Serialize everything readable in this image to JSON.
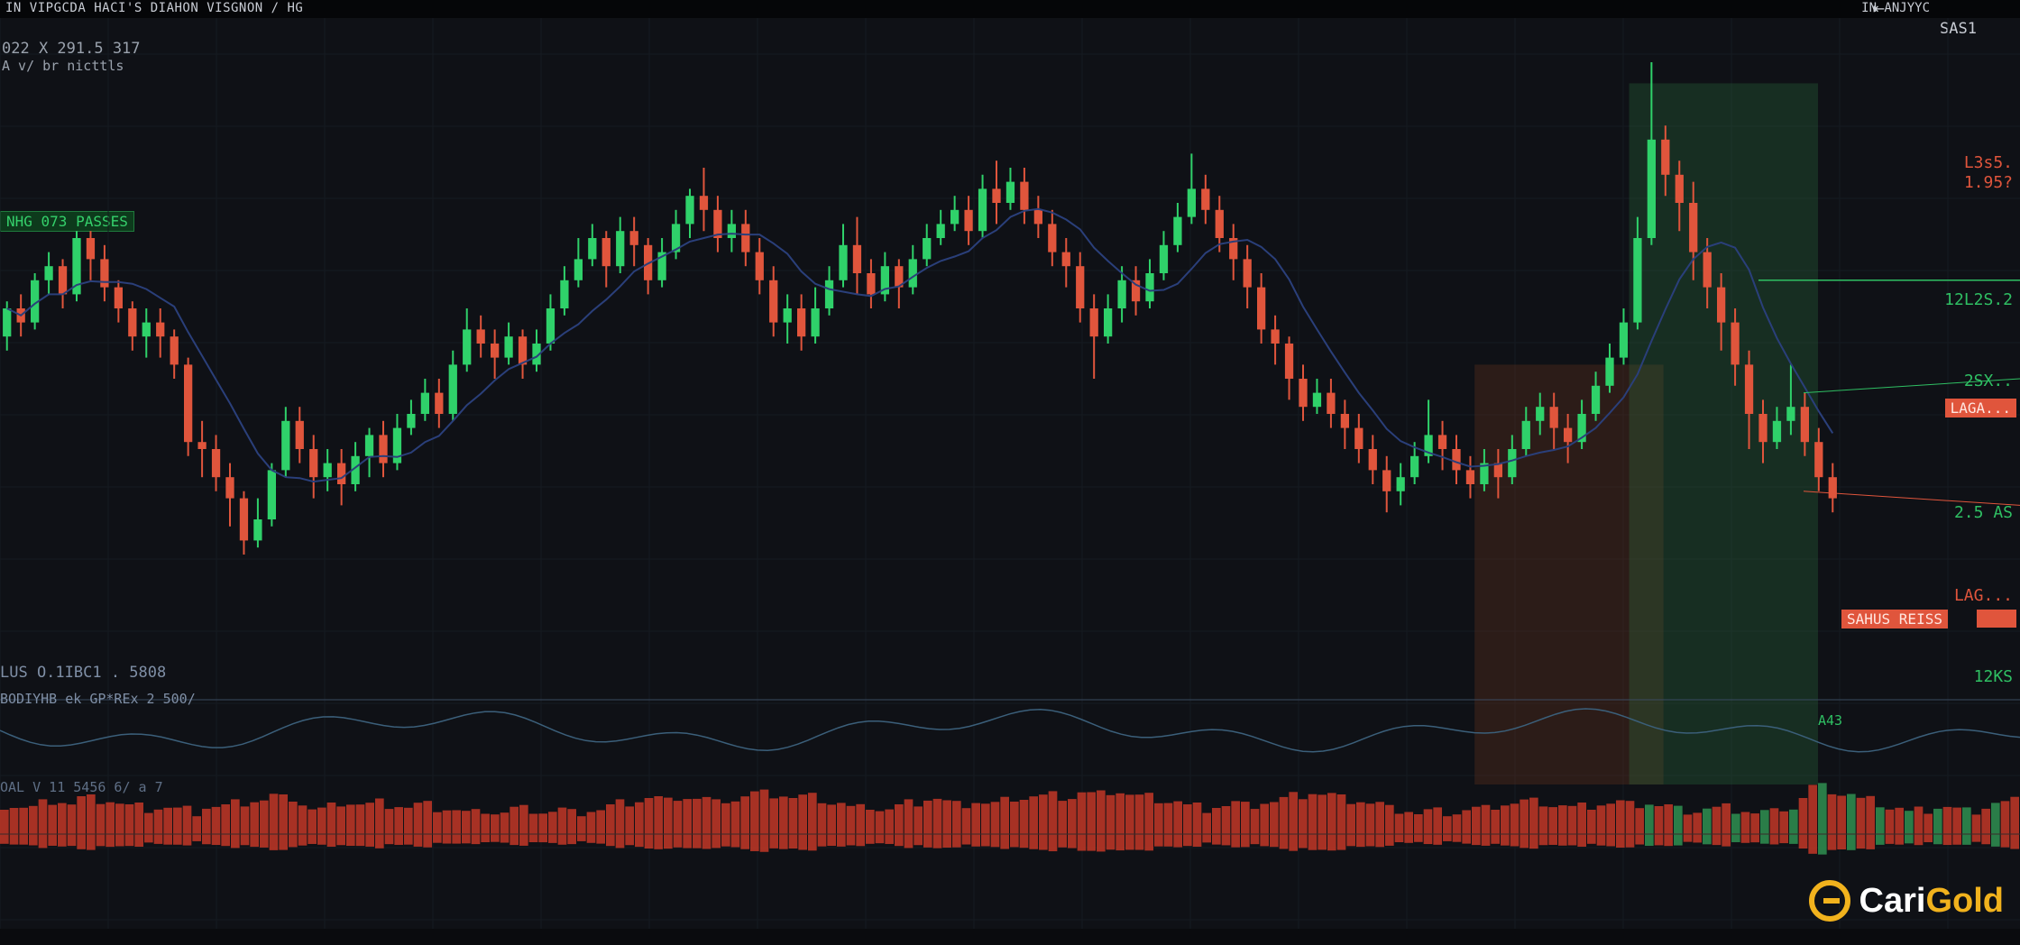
{
  "header": {
    "title": "IN VIPGCDA HACI'S DIAHON VISGNON / HG",
    "ticker": "IN ANJYYC",
    "sub_ticker": "SAS1"
  },
  "info": {
    "line1": "022 X 291.5 317",
    "line2": "A v/ br nicttls"
  },
  "badges": {
    "left_green": "NHG 073 PASSES",
    "price_red": "LAGA...",
    "sell_tag": "SAHUS REISS"
  },
  "right_axis": [
    {
      "label": "L3s5.",
      "color": "#e0553c"
    },
    {
      "label": "1.95?",
      "color": "#e0553c"
    },
    {
      "label": "12L2S.2",
      "color": "#2fbf63"
    },
    {
      "label": "2SX..",
      "color": "#2fbf63"
    },
    {
      "label": "2.5 AS",
      "color": "#2fbf63"
    },
    {
      "label": "LAG...",
      "color": "#e0553c"
    },
    {
      "label": "12KS",
      "color": "#2fbf63"
    },
    {
      "label": "A43",
      "color": "#2fbf63"
    }
  ],
  "indicators": {
    "line1": "LUS O.1IBC1 . 5808",
    "line2": "BODIYHB ek GP*REx 2 500/",
    "line3": "OAL V 11 5456 6/ a 7"
  },
  "brand": {
    "part1": "Cari",
    "part2": "Gold"
  },
  "chart_data": {
    "type": "candlestick",
    "title": "",
    "colors": {
      "up": "#2fd16a",
      "down": "#e0553c",
      "ma": "#2a3f7a",
      "bg": "#0f1116"
    },
    "candles": [
      [
        0.56,
        0.6,
        0.54,
        0.61
      ],
      [
        0.6,
        0.58,
        0.56,
        0.62
      ],
      [
        0.58,
        0.64,
        0.57,
        0.65
      ],
      [
        0.64,
        0.66,
        0.62,
        0.68
      ],
      [
        0.66,
        0.62,
        0.6,
        0.67
      ],
      [
        0.62,
        0.7,
        0.61,
        0.71
      ],
      [
        0.7,
        0.67,
        0.64,
        0.71
      ],
      [
        0.67,
        0.63,
        0.61,
        0.69
      ],
      [
        0.63,
        0.6,
        0.58,
        0.64
      ],
      [
        0.6,
        0.56,
        0.54,
        0.61
      ],
      [
        0.56,
        0.58,
        0.53,
        0.6
      ],
      [
        0.58,
        0.56,
        0.53,
        0.6
      ],
      [
        0.56,
        0.52,
        0.5,
        0.57
      ],
      [
        0.52,
        0.41,
        0.39,
        0.53
      ],
      [
        0.41,
        0.4,
        0.36,
        0.44
      ],
      [
        0.4,
        0.36,
        0.34,
        0.42
      ],
      [
        0.36,
        0.33,
        0.29,
        0.38
      ],
      [
        0.33,
        0.27,
        0.25,
        0.34
      ],
      [
        0.27,
        0.3,
        0.26,
        0.33
      ],
      [
        0.3,
        0.37,
        0.29,
        0.38
      ],
      [
        0.37,
        0.44,
        0.36,
        0.46
      ],
      [
        0.44,
        0.4,
        0.38,
        0.46
      ],
      [
        0.4,
        0.36,
        0.33,
        0.42
      ],
      [
        0.36,
        0.38,
        0.34,
        0.4
      ],
      [
        0.38,
        0.35,
        0.32,
        0.4
      ],
      [
        0.35,
        0.39,
        0.34,
        0.41
      ],
      [
        0.39,
        0.42,
        0.36,
        0.43
      ],
      [
        0.42,
        0.38,
        0.36,
        0.44
      ],
      [
        0.38,
        0.43,
        0.37,
        0.45
      ],
      [
        0.43,
        0.45,
        0.42,
        0.47
      ],
      [
        0.45,
        0.48,
        0.44,
        0.5
      ],
      [
        0.48,
        0.45,
        0.43,
        0.5
      ],
      [
        0.45,
        0.52,
        0.44,
        0.54
      ],
      [
        0.52,
        0.57,
        0.51,
        0.6
      ],
      [
        0.57,
        0.55,
        0.53,
        0.59
      ],
      [
        0.55,
        0.53,
        0.5,
        0.57
      ],
      [
        0.53,
        0.56,
        0.52,
        0.58
      ],
      [
        0.56,
        0.52,
        0.5,
        0.57
      ],
      [
        0.52,
        0.55,
        0.51,
        0.57
      ],
      [
        0.55,
        0.6,
        0.54,
        0.62
      ],
      [
        0.6,
        0.64,
        0.59,
        0.66
      ],
      [
        0.64,
        0.67,
        0.63,
        0.7
      ],
      [
        0.67,
        0.7,
        0.66,
        0.72
      ],
      [
        0.7,
        0.66,
        0.63,
        0.71
      ],
      [
        0.66,
        0.71,
        0.65,
        0.73
      ],
      [
        0.71,
        0.69,
        0.66,
        0.73
      ],
      [
        0.69,
        0.64,
        0.62,
        0.7
      ],
      [
        0.64,
        0.68,
        0.63,
        0.7
      ],
      [
        0.68,
        0.72,
        0.67,
        0.74
      ],
      [
        0.72,
        0.76,
        0.7,
        0.77
      ],
      [
        0.76,
        0.74,
        0.71,
        0.8
      ],
      [
        0.74,
        0.7,
        0.68,
        0.76
      ],
      [
        0.7,
        0.72,
        0.68,
        0.74
      ],
      [
        0.72,
        0.68,
        0.66,
        0.74
      ],
      [
        0.68,
        0.64,
        0.62,
        0.7
      ],
      [
        0.64,
        0.58,
        0.56,
        0.66
      ],
      [
        0.58,
        0.6,
        0.55,
        0.62
      ],
      [
        0.6,
        0.56,
        0.54,
        0.62
      ],
      [
        0.56,
        0.6,
        0.55,
        0.63
      ],
      [
        0.6,
        0.64,
        0.59,
        0.66
      ],
      [
        0.64,
        0.69,
        0.63,
        0.72
      ],
      [
        0.69,
        0.65,
        0.62,
        0.73
      ],
      [
        0.65,
        0.62,
        0.6,
        0.67
      ],
      [
        0.62,
        0.66,
        0.61,
        0.68
      ],
      [
        0.66,
        0.63,
        0.6,
        0.67
      ],
      [
        0.63,
        0.67,
        0.62,
        0.69
      ],
      [
        0.67,
        0.7,
        0.66,
        0.72
      ],
      [
        0.7,
        0.72,
        0.69,
        0.74
      ],
      [
        0.72,
        0.74,
        0.71,
        0.76
      ],
      [
        0.74,
        0.71,
        0.69,
        0.76
      ],
      [
        0.71,
        0.77,
        0.7,
        0.79
      ],
      [
        0.77,
        0.75,
        0.72,
        0.81
      ],
      [
        0.75,
        0.78,
        0.74,
        0.8
      ],
      [
        0.78,
        0.74,
        0.72,
        0.8
      ],
      [
        0.74,
        0.72,
        0.7,
        0.76
      ],
      [
        0.72,
        0.68,
        0.66,
        0.74
      ],
      [
        0.68,
        0.66,
        0.63,
        0.7
      ],
      [
        0.66,
        0.6,
        0.58,
        0.68
      ],
      [
        0.6,
        0.56,
        0.5,
        0.62
      ],
      [
        0.56,
        0.6,
        0.55,
        0.62
      ],
      [
        0.6,
        0.64,
        0.58,
        0.66
      ],
      [
        0.64,
        0.61,
        0.59,
        0.66
      ],
      [
        0.61,
        0.65,
        0.6,
        0.67
      ],
      [
        0.65,
        0.69,
        0.64,
        0.71
      ],
      [
        0.69,
        0.73,
        0.68,
        0.75
      ],
      [
        0.73,
        0.77,
        0.72,
        0.82
      ],
      [
        0.77,
        0.74,
        0.72,
        0.79
      ],
      [
        0.74,
        0.7,
        0.68,
        0.76
      ],
      [
        0.7,
        0.67,
        0.64,
        0.72
      ],
      [
        0.67,
        0.63,
        0.6,
        0.69
      ],
      [
        0.63,
        0.57,
        0.55,
        0.65
      ],
      [
        0.57,
        0.55,
        0.52,
        0.59
      ],
      [
        0.55,
        0.5,
        0.47,
        0.56
      ],
      [
        0.5,
        0.46,
        0.44,
        0.52
      ],
      [
        0.46,
        0.48,
        0.45,
        0.5
      ],
      [
        0.48,
        0.45,
        0.43,
        0.5
      ],
      [
        0.45,
        0.43,
        0.4,
        0.47
      ],
      [
        0.43,
        0.4,
        0.38,
        0.45
      ],
      [
        0.4,
        0.37,
        0.35,
        0.42
      ],
      [
        0.37,
        0.34,
        0.31,
        0.39
      ],
      [
        0.34,
        0.36,
        0.32,
        0.38
      ],
      [
        0.36,
        0.39,
        0.35,
        0.41
      ],
      [
        0.39,
        0.42,
        0.38,
        0.47
      ],
      [
        0.42,
        0.4,
        0.37,
        0.44
      ],
      [
        0.4,
        0.37,
        0.35,
        0.42
      ],
      [
        0.37,
        0.35,
        0.33,
        0.39
      ],
      [
        0.35,
        0.38,
        0.34,
        0.4
      ],
      [
        0.38,
        0.36,
        0.33,
        0.4
      ],
      [
        0.36,
        0.4,
        0.35,
        0.42
      ],
      [
        0.4,
        0.44,
        0.39,
        0.46
      ],
      [
        0.44,
        0.46,
        0.42,
        0.48
      ],
      [
        0.46,
        0.43,
        0.4,
        0.48
      ],
      [
        0.43,
        0.41,
        0.38,
        0.45
      ],
      [
        0.41,
        0.45,
        0.4,
        0.47
      ],
      [
        0.45,
        0.49,
        0.44,
        0.51
      ],
      [
        0.49,
        0.53,
        0.48,
        0.55
      ],
      [
        0.53,
        0.58,
        0.52,
        0.6
      ],
      [
        0.58,
        0.7,
        0.57,
        0.73
      ],
      [
        0.7,
        0.84,
        0.69,
        0.95
      ],
      [
        0.84,
        0.79,
        0.76,
        0.86
      ],
      [
        0.79,
        0.75,
        0.71,
        0.81
      ],
      [
        0.75,
        0.68,
        0.64,
        0.78
      ],
      [
        0.68,
        0.63,
        0.6,
        0.7
      ],
      [
        0.63,
        0.58,
        0.54,
        0.65
      ],
      [
        0.58,
        0.52,
        0.49,
        0.6
      ],
      [
        0.52,
        0.45,
        0.4,
        0.54
      ],
      [
        0.45,
        0.41,
        0.38,
        0.47
      ],
      [
        0.41,
        0.44,
        0.4,
        0.46
      ],
      [
        0.44,
        0.46,
        0.42,
        0.52
      ],
      [
        0.46,
        0.41,
        0.39,
        0.48
      ],
      [
        0.41,
        0.36,
        0.34,
        0.43
      ],
      [
        0.36,
        0.33,
        0.31,
        0.38
      ]
    ],
    "overlay_band": {
      "from": 0.73,
      "to": 0.9
    }
  }
}
